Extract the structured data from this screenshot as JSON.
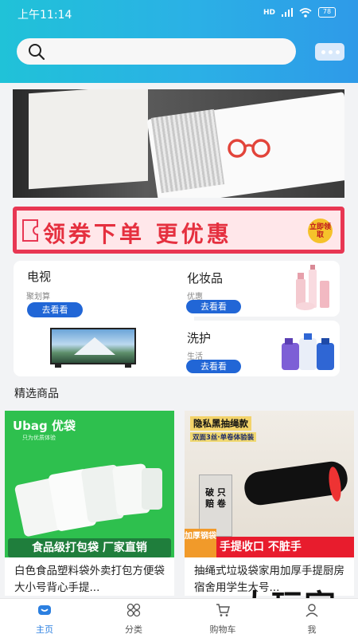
{
  "status_bar": {
    "time": "上午11:14",
    "signal": "HD",
    "battery": "78"
  },
  "search": {
    "placeholder": ""
  },
  "coupon": {
    "text": "领券下单 更优惠",
    "badge": "立即领取"
  },
  "categories": [
    {
      "title": "电视",
      "subtitle": "聚划算",
      "button": "去看看",
      "image": "tv-image"
    },
    {
      "title": "化妆品",
      "subtitle": "优惠",
      "button": "去看看",
      "image": "cosmetics-image"
    },
    {
      "title": "洗护",
      "subtitle": "生活",
      "button": "去看看",
      "image": "detergent-image"
    }
  ],
  "section": {
    "title": "精选商品"
  },
  "products": [
    {
      "name": "白色食品塑料袋外卖打包方便袋大小号背心手提...",
      "brand": "Ubag 优袋",
      "brand_sub": "只为优质体验",
      "banner": "食品级打包袋 厂家直销"
    },
    {
      "name": "抽绳式垃圾袋家用加厚手提厨房宿舍用学生大号...",
      "tag": "隐私黑抽绳款",
      "tag2": "双面3丝·单卷体验装",
      "bin_text": "破 只 赔 卷",
      "corner": "加厚钢袋",
      "banner": "手提收口 不脏手"
    }
  ],
  "tabs": [
    {
      "label": "主页",
      "icon": "home-icon",
      "active": true
    },
    {
      "label": "分类",
      "icon": "category-icon",
      "active": false
    },
    {
      "label": "购物车",
      "icon": "cart-icon",
      "active": false
    },
    {
      "label": "我",
      "icon": "user-icon",
      "active": false
    }
  ],
  "watermark": "大玩家",
  "colors": {
    "header_start": "#20c2d8",
    "header_end": "#2e9ae8",
    "accent": "#2166d6",
    "coupon_red": "#e83753",
    "active_tab": "#2b7fe0"
  }
}
